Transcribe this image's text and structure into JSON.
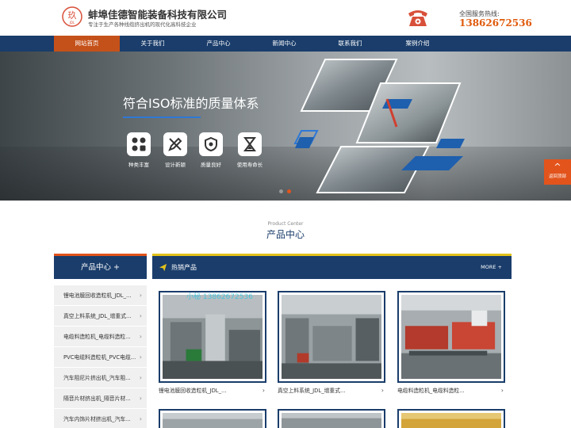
{
  "header": {
    "company_name": "蚌埠佳德智能装备科技有限公司",
    "slogan": "专注于生产各种线缆挤出机的现代化高科技企业",
    "hotline_label": "全国服务热线:",
    "hotline_number": "13862672536",
    "logo_icon": "company-logo-icon",
    "phone_icon": "telephone-icon"
  },
  "nav": {
    "items": [
      {
        "label": "网站首页",
        "active": true
      },
      {
        "label": "关于我们"
      },
      {
        "label": "产品中心"
      },
      {
        "label": "新闻中心"
      },
      {
        "label": "联系我们"
      },
      {
        "label": "案例介绍"
      }
    ]
  },
  "banner": {
    "title": "符合ISO标准的质量体系",
    "features": [
      {
        "icon": "apps-grid-icon",
        "label": "种类丰富"
      },
      {
        "icon": "design-pencil-icon",
        "label": "设计新颖"
      },
      {
        "icon": "shield-check-icon",
        "label": "质量良好"
      },
      {
        "icon": "hourglass-icon",
        "label": "使用寿命长"
      }
    ],
    "slides": 2,
    "active_slide": 2
  },
  "back_to_top": {
    "label": "返回顶部",
    "icon": "chevron-up-icon"
  },
  "section": {
    "title_en": "Product Center",
    "title_zh": "产品中心"
  },
  "sidebar": {
    "title": "产品中心 +",
    "items": [
      {
        "label": "锂电池膜回收造粒机_JDL_..."
      },
      {
        "label": "真空上料系统_JDL_增重式..."
      },
      {
        "label": "电缆料造粒机_电缆料造粒..."
      },
      {
        "label": "PVC电缆料造粒机_PVC电缆..."
      },
      {
        "label": "汽车阻尼片挤出机_汽车阻..."
      },
      {
        "label": "隔音片材挤出机_隔音片材..."
      },
      {
        "label": "汽车内饰片材挤出机_汽车..."
      }
    ]
  },
  "hot_products": {
    "title": "热销产品",
    "more": "MORE +",
    "icon": "paper-plane-icon",
    "items": [
      {
        "caption": "锂电池膜回收造粒机_JDL_...",
        "watermark": "小秘 13862672536"
      },
      {
        "caption": "真空上料系统_JDL_增重式..."
      },
      {
        "caption": "电缆料造粒机_电缆料造粒..."
      }
    ]
  },
  "colors": {
    "navy": "#1a3d6b",
    "orange": "#e2541c",
    "nav_active": "#c5511a",
    "hotline": "#e05a0a",
    "accent_blue": "#2e78d6"
  }
}
